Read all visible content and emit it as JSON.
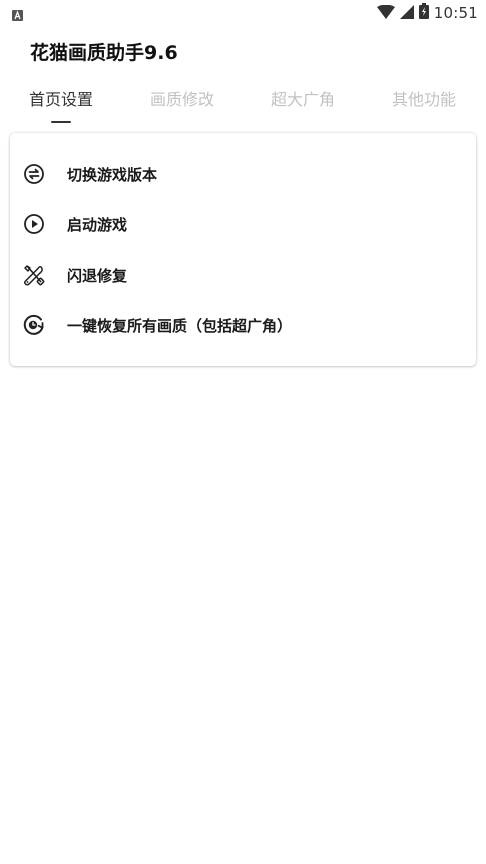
{
  "status_bar": {
    "time": "10:51",
    "left_icon": "a-notification-icon",
    "icons": [
      "wifi-icon",
      "signal-icon",
      "battery-charging-icon"
    ]
  },
  "app": {
    "title": "花猫画质助手9.6"
  },
  "tabs": [
    {
      "label": "首页设置",
      "active": true
    },
    {
      "label": "画质修改",
      "active": false
    },
    {
      "label": "超大广角",
      "active": false
    },
    {
      "label": "其他功能",
      "active": false
    }
  ],
  "menu": {
    "items": [
      {
        "label": "切换游戏版本",
        "icon": "switch-icon"
      },
      {
        "label": "启动游戏",
        "icon": "play-icon"
      },
      {
        "label": "闪退修复",
        "icon": "tools-icon"
      },
      {
        "label": "一键恢复所有画质（包括超广角）",
        "icon": "restore-icon"
      }
    ]
  },
  "colors": {
    "tab_active": "#333333",
    "tab_inactive": "#c2c2c2",
    "background": "#ffffff"
  }
}
